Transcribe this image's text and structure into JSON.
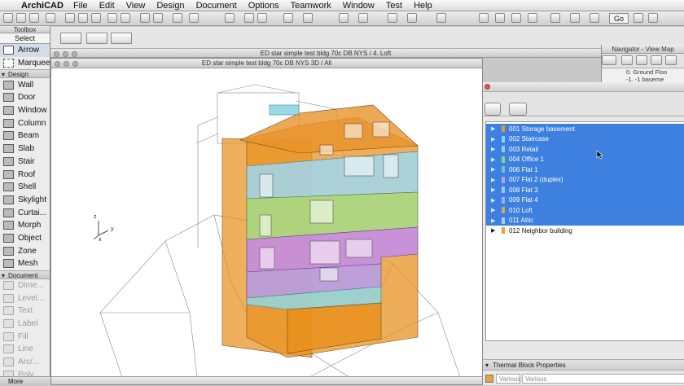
{
  "menubar": {
    "apple": "",
    "app_name": "ArchiCAD",
    "items": [
      "File",
      "Edit",
      "View",
      "Design",
      "Document",
      "Options",
      "Teamwork",
      "Window",
      "Test",
      "Help"
    ]
  },
  "toolbar": {
    "go_label": "Go"
  },
  "toolbox": {
    "title": "Toolbox",
    "select_label": "Select",
    "arrow_tools": [
      "Arrow",
      "Marquee"
    ],
    "design_group": "Design",
    "design_tools": [
      "Wall",
      "Door",
      "Window",
      "Column",
      "Beam",
      "Slab",
      "Stair",
      "Roof",
      "Shell",
      "Skylight",
      "Curtai...",
      "Morph",
      "Object",
      "Zone",
      "Mesh"
    ],
    "document_group": "Document",
    "document_tools": [
      "Dime...",
      "Level...",
      "Text",
      "Label",
      "Fill",
      "Line",
      "Arc/...",
      "Poly..."
    ],
    "more_label": "More"
  },
  "plan_window": {
    "title": "ED star simple test bldg 70c DB NYS / 4. Loft"
  },
  "view3d_window": {
    "title": "ED star simple test bldg 70c DB NYS 3D / All"
  },
  "axes": {
    "z": "z",
    "y": "y",
    "x": "x"
  },
  "navigator": {
    "title": "Navigator - View Map",
    "rows": [
      "0. Ground Floo",
      "-1. -1 baseme"
    ]
  },
  "layers": {
    "rows": [
      {
        "label": "001 Storage basement",
        "color": "#e89a2c",
        "selected": true
      },
      {
        "label": "002 Staircase",
        "color": "#7fd8e6",
        "selected": true
      },
      {
        "label": "003 Retail",
        "color": "#9ec6f0",
        "selected": true
      },
      {
        "label": "004 Office 1",
        "color": "#8fd17a",
        "selected": true
      },
      {
        "label": "006 Flat 1",
        "color": "#6bc4d8",
        "selected": true
      },
      {
        "label": "007 Flat 2 (duplex)",
        "color": "#b6a0e8",
        "selected": true
      },
      {
        "label": "008 Flat 3",
        "color": "#9cc4ef",
        "selected": true
      },
      {
        "label": "009 Flat 4",
        "color": "#8ab6ea",
        "selected": true
      },
      {
        "label": "010 Loft",
        "color": "#d8a266",
        "selected": true
      },
      {
        "label": "011 Attic",
        "color": "#b0c8ec",
        "selected": true
      },
      {
        "label": "012 Neighbor building",
        "color": "#e8a040",
        "selected": false
      }
    ]
  },
  "properties": {
    "title": "Thermal Block Properties",
    "field1": "Various",
    "field2": "Various"
  }
}
